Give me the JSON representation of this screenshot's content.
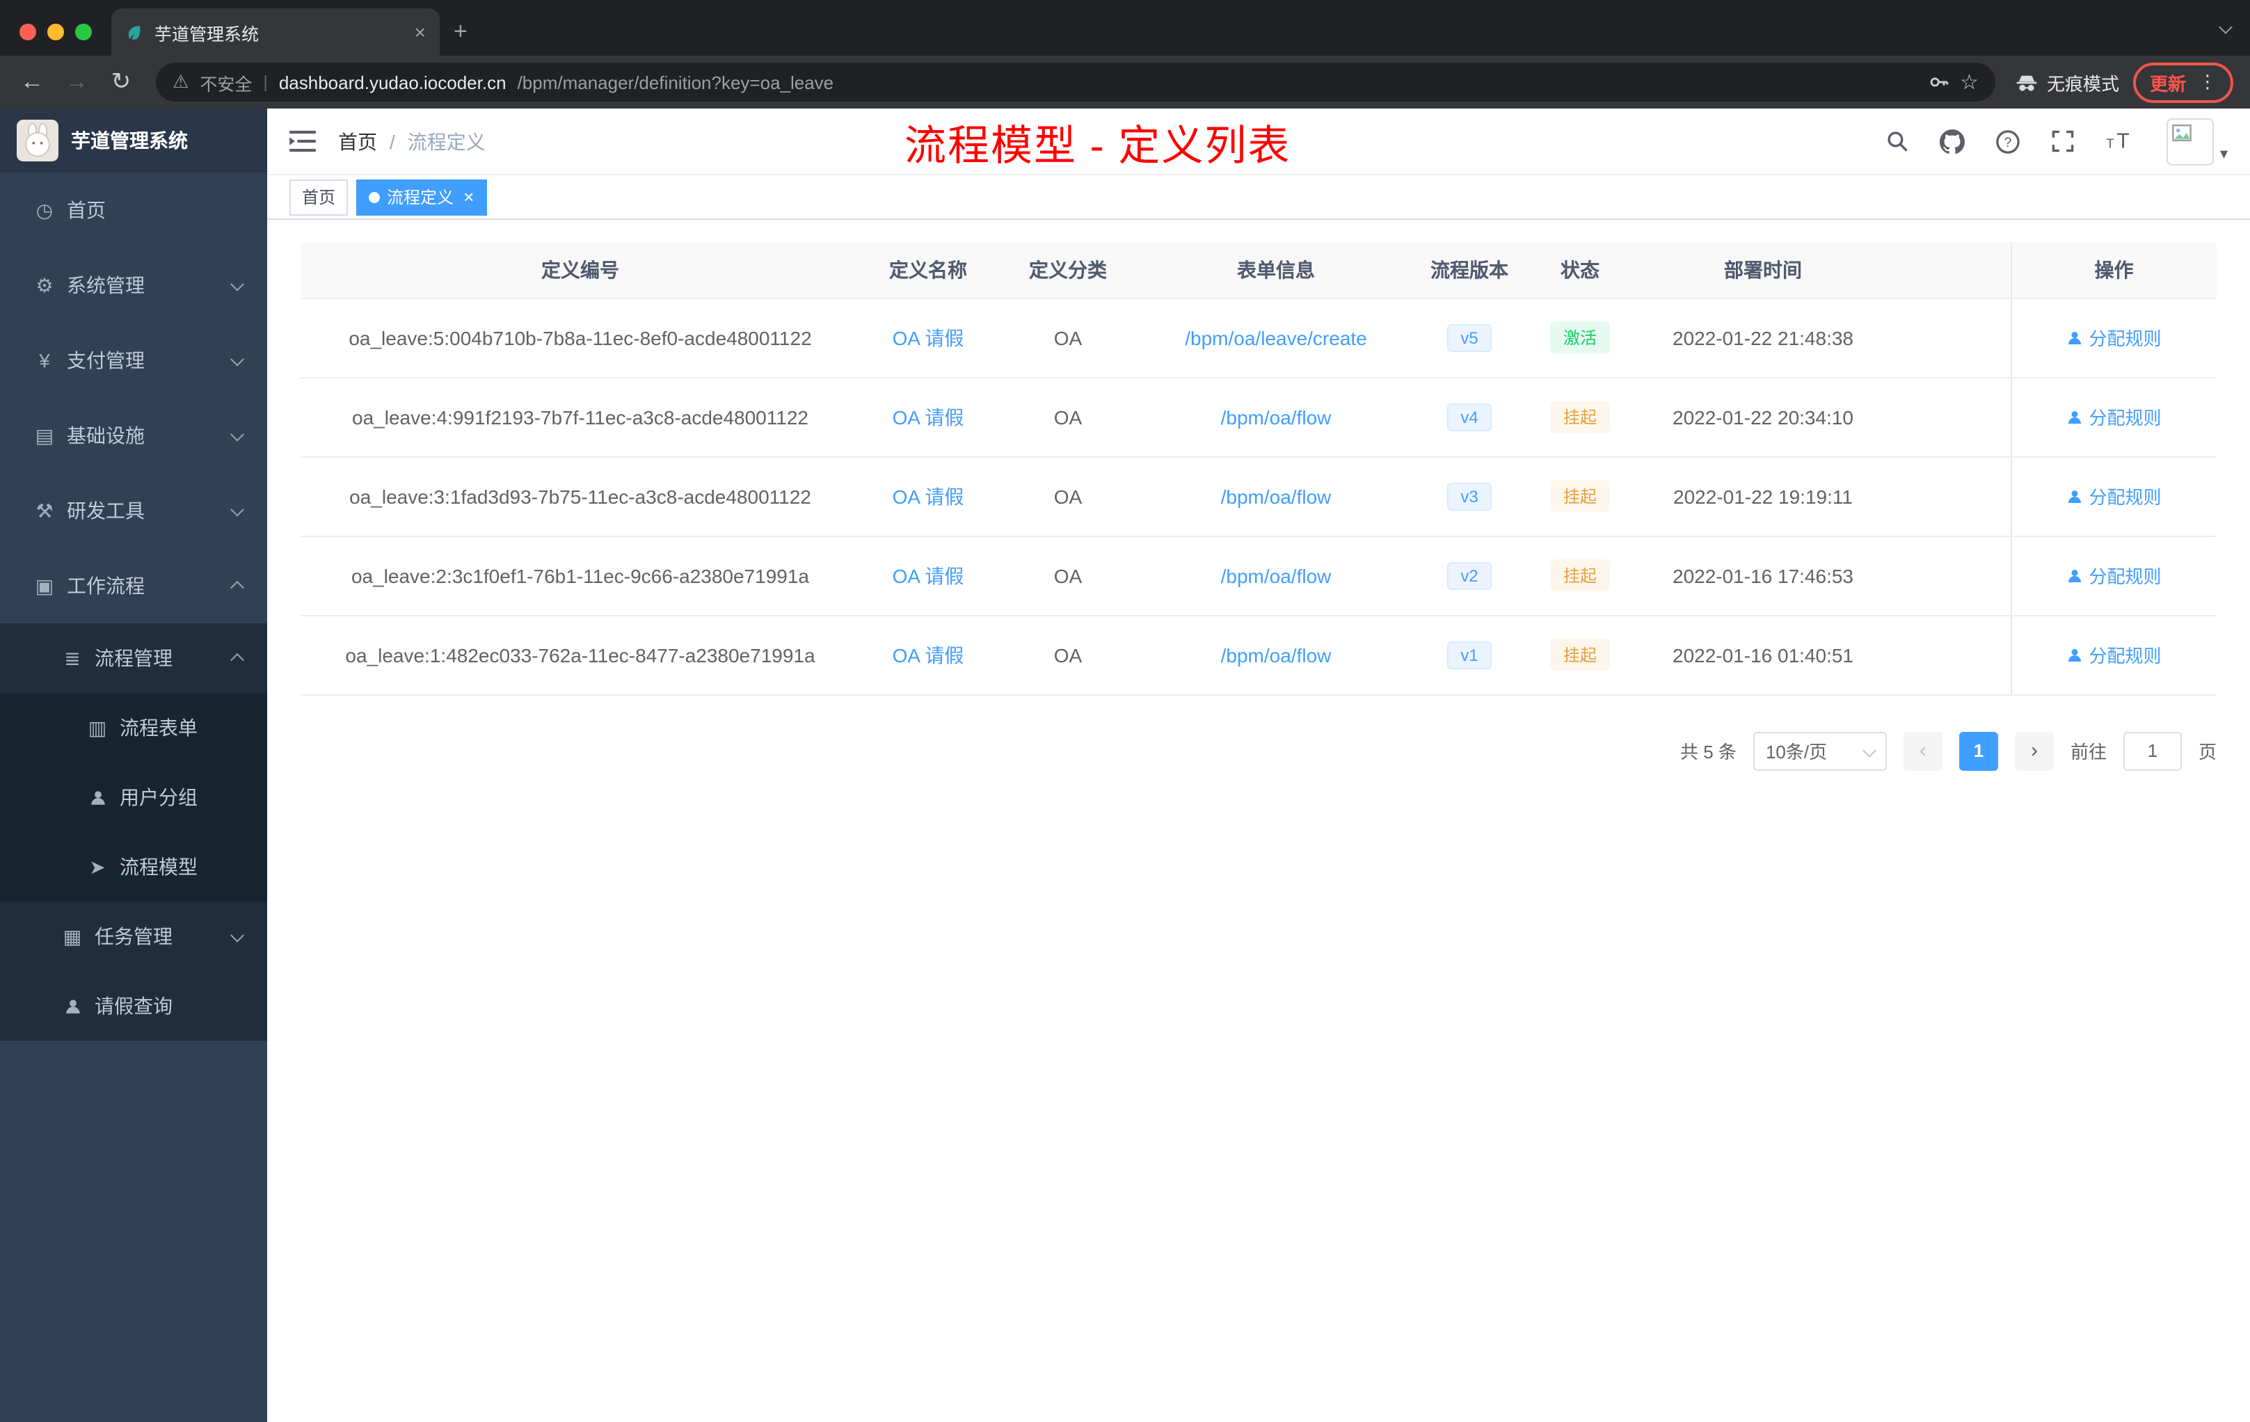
{
  "colors": {
    "accent": "#409eff",
    "success": "#13ce66",
    "warning": "#e6a23c",
    "annotation_red": "#fe0000",
    "sidebar_bg": "#304156",
    "submenu_bg": "#1f2d3d"
  },
  "icons": {
    "back": "←",
    "forward": "→",
    "reload": "↻",
    "warning": "⚠",
    "star": "☆",
    "kebab": "⋮",
    "close": "×",
    "new_tab": "+",
    "caret": "▾",
    "prev": "‹",
    "next": "›",
    "home": "◷",
    "system": "⚙",
    "payment": "¥",
    "infra": "▤",
    "devtools": "⚒",
    "workflow": "▣",
    "process_mgmt": "≣",
    "process_form": "▥",
    "process_model": "➤",
    "task_mgmt": "▦"
  },
  "browser": {
    "tab_title": "芋道管理系统",
    "security_label": "不安全",
    "url_host": "dashboard.yudao.iocoder.cn",
    "url_path": "/bpm/manager/definition?key=oa_leave",
    "url_sep": "|",
    "incognito_label": "无痕模式",
    "update_label": "更新"
  },
  "sidebar": {
    "logo_title": "芋道管理系统",
    "items": [
      {
        "label": "首页"
      },
      {
        "label": "系统管理"
      },
      {
        "label": "支付管理"
      },
      {
        "label": "基础设施"
      },
      {
        "label": "研发工具"
      },
      {
        "label": "工作流程"
      },
      {
        "label": "流程管理"
      },
      {
        "label": "流程表单"
      },
      {
        "label": "用户分组"
      },
      {
        "label": "流程模型"
      },
      {
        "label": "任务管理"
      },
      {
        "label": "请假查询"
      }
    ]
  },
  "header": {
    "breadcrumb": [
      "首页",
      "流程定义"
    ],
    "breadcrumb_sep": "/",
    "annotation": "流程模型 - 定义列表"
  },
  "tags": [
    {
      "label": "首页"
    },
    {
      "label": "流程定义"
    }
  ],
  "table": {
    "headers": [
      "定义编号",
      "定义名称",
      "定义分类",
      "表单信息",
      "流程版本",
      "状态",
      "部署时间",
      "操作"
    ],
    "rows": [
      {
        "id": "oa_leave:5:004b710b-7b8a-11ec-8ef0-acde48001122",
        "name": "OA 请假",
        "category": "OA",
        "form": "/bpm/oa/leave/create",
        "version": "v5",
        "status": "激活",
        "time": "2022-01-22 21:48:38",
        "action": "分配规则"
      },
      {
        "id": "oa_leave:4:991f2193-7b7f-11ec-a3c8-acde48001122",
        "name": "OA 请假",
        "category": "OA",
        "form": "/bpm/oa/flow",
        "version": "v4",
        "status": "挂起",
        "time": "2022-01-22 20:34:10",
        "action": "分配规则"
      },
      {
        "id": "oa_leave:3:1fad3d93-7b75-11ec-a3c8-acde48001122",
        "name": "OA 请假",
        "category": "OA",
        "form": "/bpm/oa/flow",
        "version": "v3",
        "status": "挂起",
        "time": "2022-01-22 19:19:11",
        "action": "分配规则"
      },
      {
        "id": "oa_leave:2:3c1f0ef1-76b1-11ec-9c66-a2380e71991a",
        "name": "OA 请假",
        "category": "OA",
        "form": "/bpm/oa/flow",
        "version": "v2",
        "status": "挂起",
        "time": "2022-01-16 17:46:53",
        "action": "分配规则"
      },
      {
        "id": "oa_leave:1:482ec033-762a-11ec-8477-a2380e71991a",
        "name": "OA 请假",
        "category": "OA",
        "form": "/bpm/oa/flow",
        "version": "v1",
        "status": "挂起",
        "time": "2022-01-16 01:40:51",
        "action": "分配规则"
      }
    ]
  },
  "pagination": {
    "total": "共 5 条",
    "page_size": "10条/页",
    "current_page": "1",
    "jump_prefix": "前往",
    "jump_value": "1",
    "jump_suffix": "页"
  }
}
